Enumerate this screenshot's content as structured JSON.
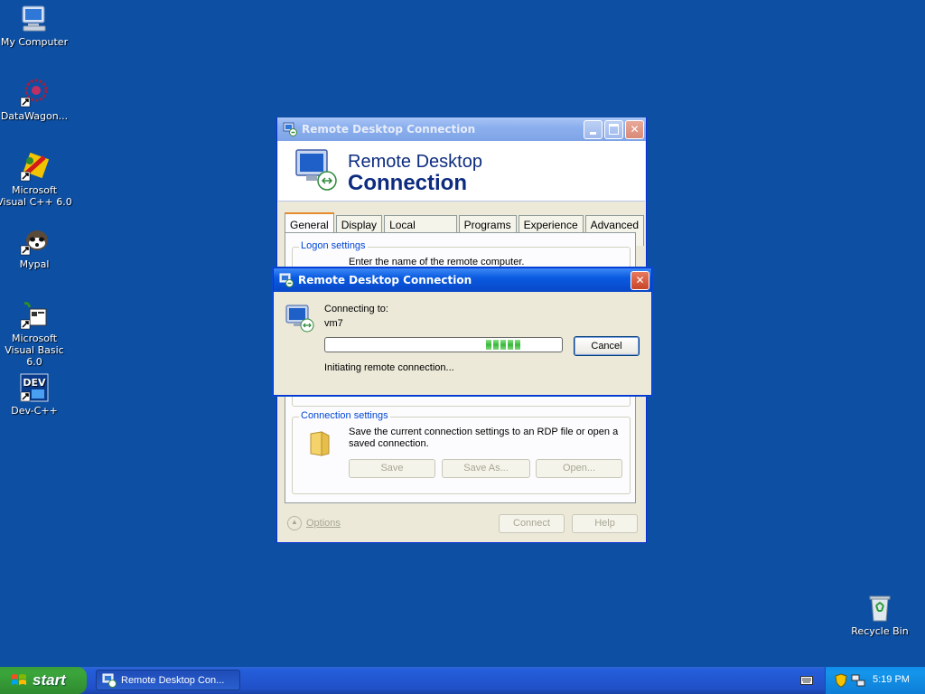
{
  "desktop": {
    "icons": [
      {
        "label": "My Computer"
      },
      {
        "label": "DataWagon..."
      },
      {
        "label": "Microsoft Visual C++ 6.0"
      },
      {
        "label": "Mypal"
      },
      {
        "label": "Microsoft Visual Basic 6.0"
      },
      {
        "label": "Dev-C++"
      },
      {
        "label": "Recycle Bin"
      }
    ]
  },
  "main_window": {
    "title": "Remote Desktop Connection",
    "banner_line1": "Remote Desktop",
    "banner_line2": "Connection",
    "tabs": [
      "General",
      "Display",
      "Local Resources",
      "Programs",
      "Experience",
      "Advanced"
    ],
    "active_tab": "General",
    "logon_group_title": "Logon settings",
    "logon_text_partial": "Enter the name of the remote computer.",
    "connection_group_title": "Connection settings",
    "connection_text": "Save the current connection settings to an RDP file or open a saved connection.",
    "buttons": {
      "save": "Save",
      "save_as": "Save As...",
      "open": "Open...",
      "options": "Options",
      "connect": "Connect",
      "help": "Help"
    }
  },
  "dialog": {
    "title": "Remote Desktop Connection",
    "connecting_label": "Connecting to:",
    "host": "vm7",
    "status": "Initiating remote connection...",
    "cancel": "Cancel",
    "progress_blocks": 5
  },
  "taskbar": {
    "start_label": "start",
    "task_label": "Remote Desktop Con...",
    "clock": "5:19 PM"
  },
  "colors": {
    "desktop": "#0d4fa3",
    "window_face": "#ece9d8",
    "accent": "#0a5ae0"
  }
}
